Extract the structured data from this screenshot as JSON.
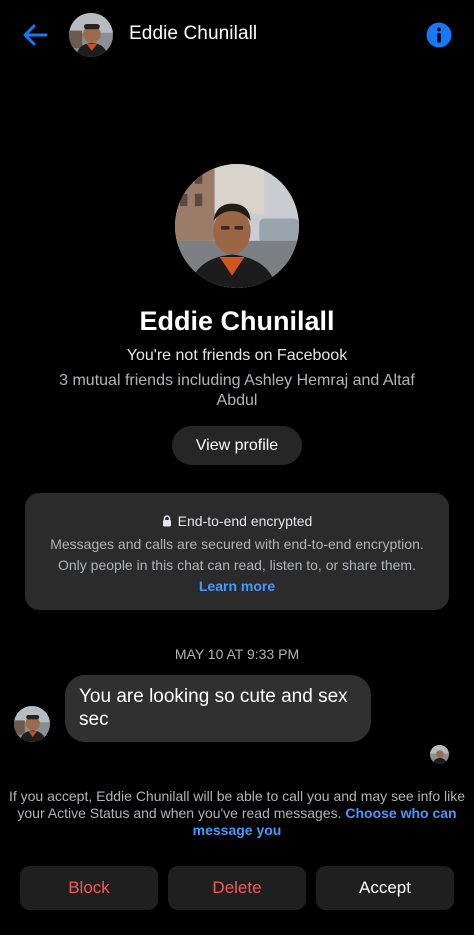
{
  "header": {
    "name": "Eddie Chunilall",
    "back_icon": "back-arrow-icon",
    "info_icon": "info-icon"
  },
  "profile": {
    "name": "Eddie Chunilall",
    "relationship": "You're not friends on Facebook",
    "mutual_friends": "3 mutual friends including Ashley Hemraj and Altaf Abdul",
    "view_profile_label": "View profile"
  },
  "encryption": {
    "title": "End-to-end encrypted",
    "body": "Messages and calls are secured with end-to-end encryption. Only people in this chat can read, listen to, or share them.",
    "learn_more": "Learn more",
    "lock_icon": "lock-icon"
  },
  "conversation": {
    "timestamp": "MAY 10 AT 9:33 PM",
    "messages": [
      {
        "text": "You are looking so cute and sex sec"
      }
    ]
  },
  "request": {
    "info_text": "If you accept, Eddie Chunilall will be able to call you and may see info like your Active Status and when you've read messages.",
    "info_link": "Choose who can message you",
    "block_label": "Block",
    "delete_label": "Delete",
    "accept_label": "Accept"
  },
  "colors": {
    "background": "#000000",
    "accent": "#1877f2",
    "link": "#4599ff",
    "danger": "#f25a5a",
    "surface": "#2b2b2b"
  }
}
